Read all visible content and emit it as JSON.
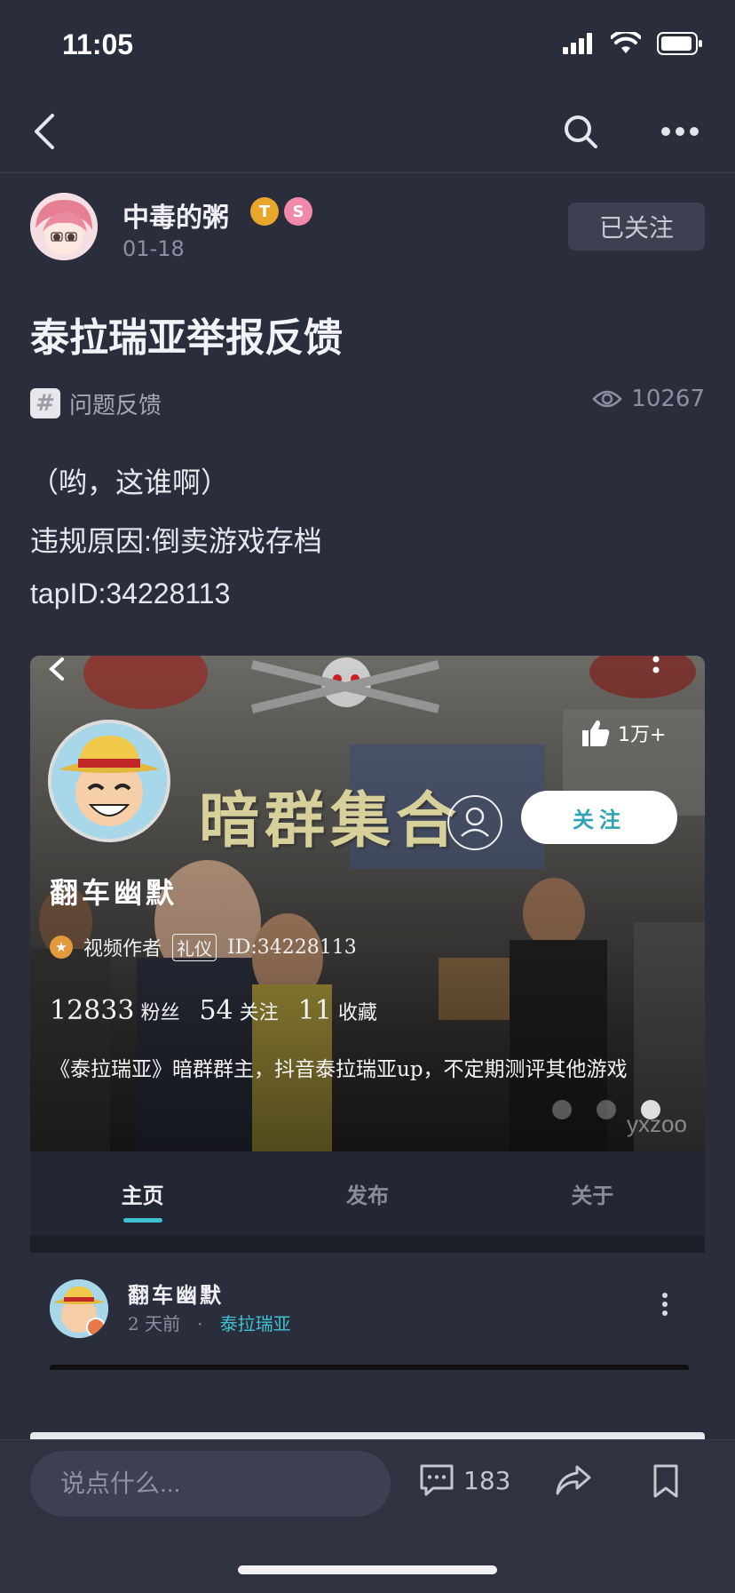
{
  "status_bar": {
    "time": "11:05"
  },
  "post": {
    "author_name": "中毒的粥",
    "badge_1": "T",
    "badge_2": "S",
    "date": "01-18",
    "follow_label": "已关注",
    "title": "泰拉瑞亚举报反馈",
    "tag": "问题反馈",
    "views": "10267",
    "body": [
      "（哟，这谁啊）",
      "违规原因:倒卖游戏存档",
      "tapID:34228113"
    ]
  },
  "embedded_screenshot": {
    "banner_title": "暗群集合",
    "likes": "1万+",
    "follow_label": "关注",
    "user_name": "翻车幽默",
    "role": "视频作者",
    "role_tag": "礼仪",
    "user_id": "ID:34228113",
    "stats": {
      "fans_num": "12833",
      "fans_label": "粉丝",
      "following_num": "54",
      "following_label": "关注",
      "collect_num": "11",
      "collect_label": "收藏"
    },
    "bio": "《泰拉瑞亚》暗群群主，抖音泰拉瑞亚up，不定期测评其他游戏",
    "watermark": "yxzoo",
    "tabs": [
      "主页",
      "发布",
      "关于"
    ],
    "feed_item": {
      "name": "翻车幽默",
      "time": "2 天前",
      "dot": "·",
      "topic": "泰拉瑞亚"
    }
  },
  "bottom_bar": {
    "comment_placeholder": "说点什么...",
    "comment_count": "183"
  },
  "colors": {
    "accent": "#3ec2d3",
    "background": "#2a2d3b"
  }
}
